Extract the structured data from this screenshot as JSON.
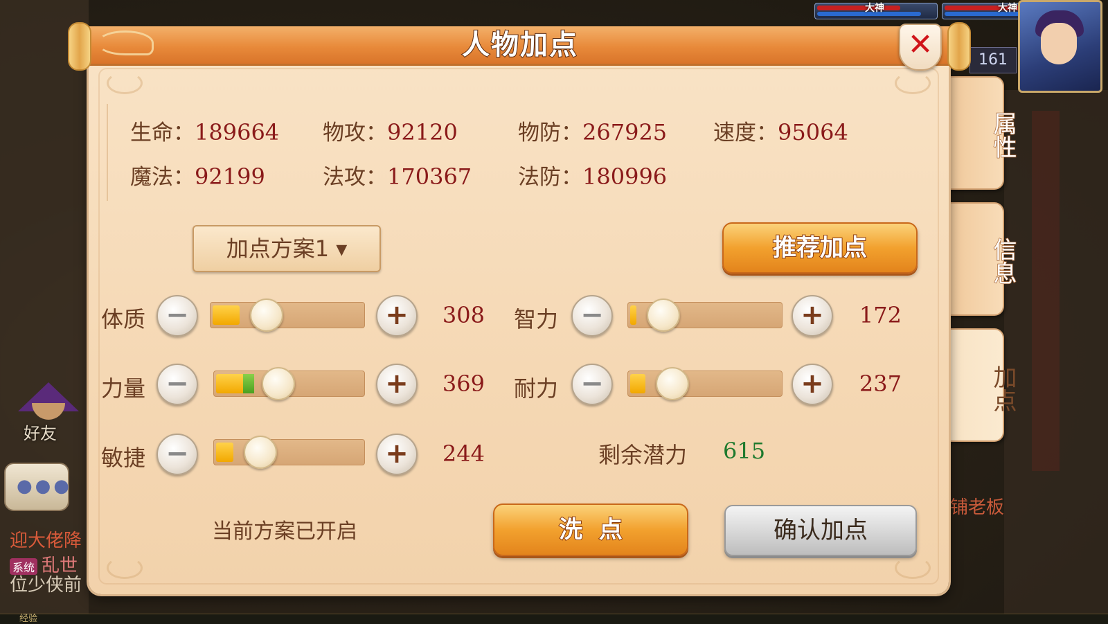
{
  "hud": {
    "tag_left": "大神",
    "tag_right": "大神",
    "level": "161"
  },
  "friend": {
    "label": "好友"
  },
  "chat": {
    "line1": "迎大佬降",
    "system_badge": "系统",
    "line2_suffix": "乱世",
    "line3": "位少侠前"
  },
  "exp_label": "经验",
  "npc_text": "铺老板",
  "panel": {
    "title": "人物加点",
    "close_label": "✕"
  },
  "stats": [
    {
      "label": "生命：",
      "value": "189664"
    },
    {
      "label": "物攻：",
      "value": "92120"
    },
    {
      "label": "物防：",
      "value": "267925"
    },
    {
      "label": "速度：",
      "value": "95064"
    },
    {
      "label": "魔法：",
      "value": "92199"
    },
    {
      "label": "法攻：",
      "value": "170367"
    },
    {
      "label": "法防：",
      "value": "180996"
    }
  ],
  "scheme_select": {
    "label": "加点方案1 ▾"
  },
  "recommend_button": "推荐加点",
  "attributes": [
    {
      "label": "体质",
      "value": "308",
      "minus": "−",
      "plus": "+",
      "fill": 0.18
    },
    {
      "label": "智力",
      "value": "172",
      "minus": "−",
      "plus": "+",
      "fill": 0.04
    },
    {
      "label": "力量",
      "value": "369",
      "minus": "−",
      "plus": "+",
      "fill": 0.24
    },
    {
      "label": "耐力",
      "value": "237",
      "minus": "−",
      "plus": "+",
      "fill": 0.1
    },
    {
      "label": "敏捷",
      "value": "244",
      "minus": "−",
      "plus": "+",
      "fill": 0.12
    }
  ],
  "remaining": {
    "label": "剩余潜力",
    "value": "615"
  },
  "status_text": "当前方案已开启",
  "reset_button": "洗  点",
  "confirm_button": "确认加点",
  "side_tabs": [
    {
      "label": "属性",
      "active": false
    },
    {
      "label": "信息",
      "active": false
    },
    {
      "label": "加点",
      "active": true
    }
  ],
  "colors": {
    "title_orange": "#e88a3a",
    "value_red": "#8a1a1a",
    "label_brown": "#6b3f24",
    "remaining_green": "#1e7a2e",
    "slider_fill": "#f2a800",
    "close_red": "#d0141a"
  },
  "icons": [
    "close-icon",
    "minus-icon",
    "plus-icon",
    "dropdown-caret-icon"
  ]
}
